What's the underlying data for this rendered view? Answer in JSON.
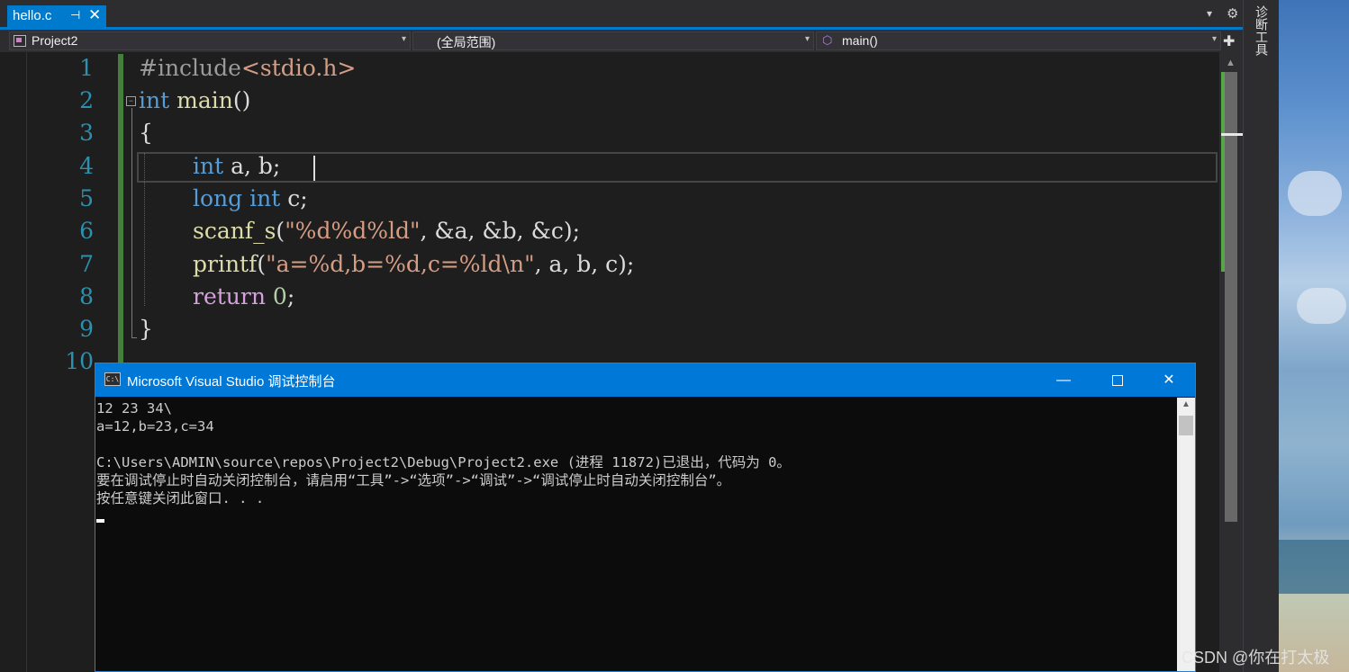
{
  "tab": {
    "title": "hello.c",
    "pin_glyph": "⊣",
    "close_glyph": "✕"
  },
  "tabbar": {
    "dropdown_glyph": "▾",
    "gear_glyph": "⚙"
  },
  "navbar": {
    "project": "Project2",
    "scope": "(全局范围)",
    "member": "main()",
    "arrow_glyph": "▾"
  },
  "side_panel": {
    "label": "诊断工具"
  },
  "editor": {
    "line_numbers": [
      "1",
      "2",
      "3",
      "4",
      "5",
      "6",
      "7",
      "8",
      "9",
      "10"
    ],
    "lines": {
      "l1_include": "#include",
      "l1_header": "<stdio.h>",
      "l2_type": "int",
      "l2_name": "main",
      "l2_parens": "()",
      "l3_brace": "{",
      "l4_type": "int",
      "l4_vars": "a, b;",
      "l5_type": "long int",
      "l5_var": "c",
      "l5_semi": ";",
      "l6_fn": "scanf_s",
      "l6_open": "(",
      "l6_str": "\"%d%d%ld\"",
      "l6_args": ", &a, &b, &c);",
      "l7_fn": "printf",
      "l7_open": "(",
      "l7_str": "\"a=%d,b=%d,c=%ld\\n\"",
      "l7_args": ", a, b, c);",
      "l8_kw": "return",
      "l8_num": "0",
      "l8_semi": ";",
      "l9_brace": "}"
    }
  },
  "console": {
    "title": "Microsoft Visual Studio 调试控制台",
    "icon_text": "C:\\",
    "minimize_glyph": "—",
    "close_glyph": "✕",
    "output": [
      "12 23 34\\",
      "a=12,b=23,c=34",
      "",
      "C:\\Users\\ADMIN\\source\\repos\\Project2\\Debug\\Project2.exe (进程 11872)已退出，代码为 0。",
      "要在调试停止时自动关闭控制台，请启用“工具”->“选项”->“调试”->“调试停止时自动关闭控制台”。",
      "按任意键关闭此窗口. . ."
    ]
  },
  "watermark": "CSDN @你在打太极",
  "colors": {
    "accent": "#007acc",
    "console_title": "#0078d7",
    "keyword": "#569cd6",
    "function": "#dcdcaa",
    "string": "#d69d85",
    "line_number": "#2b91af"
  }
}
